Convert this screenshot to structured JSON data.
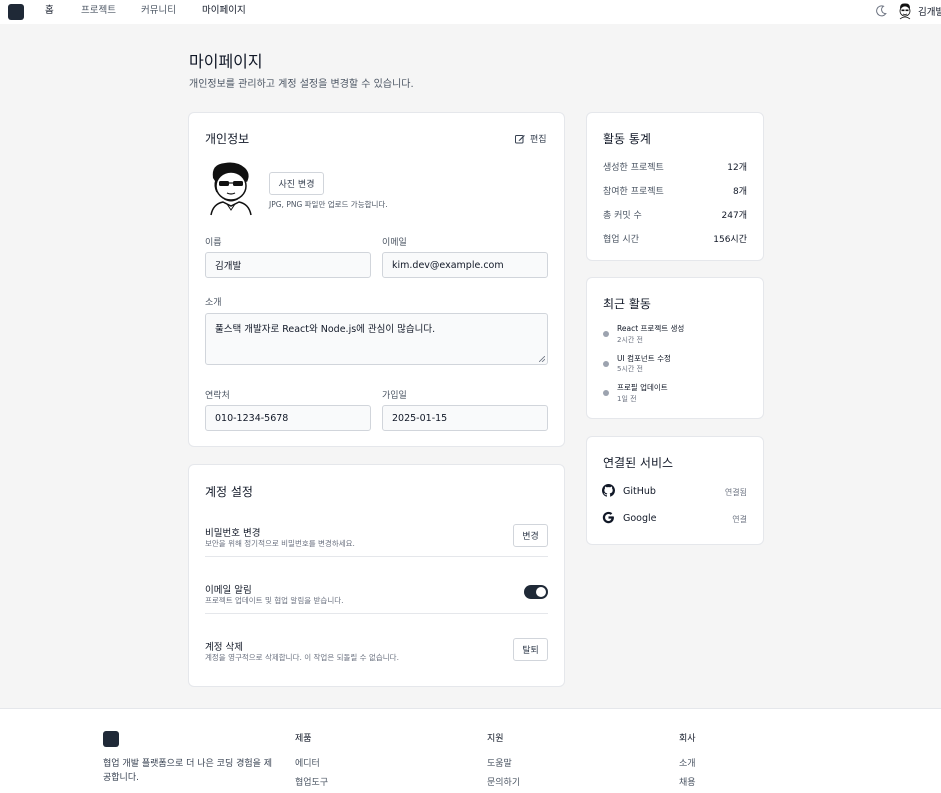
{
  "nav": {
    "items": [
      "홈",
      "프로젝트",
      "커뮤니티",
      "마이페이지"
    ],
    "user_name": "김개발"
  },
  "page": {
    "title": "마이페이지",
    "subtitle": "개인정보를 관리하고 계정 설정을 변경할 수 있습니다."
  },
  "profile": {
    "title": "개인정보",
    "edit_label": "편집",
    "photo_button": "사진 변경",
    "photo_hint": "JPG, PNG 파일만 업로드 가능합니다.",
    "name_label": "이름",
    "name_value": "김개발",
    "email_label": "이메일",
    "email_value": "kim.dev@example.com",
    "bio_label": "소개",
    "bio_value": "풀스택 개발자로 React와 Node.js에 관심이 많습니다.",
    "phone_label": "연락처",
    "phone_value": "010-1234-5678",
    "joined_label": "가입일",
    "joined_value": "2025-01-15"
  },
  "account": {
    "title": "계정 설정",
    "password": {
      "title": "비밀번호 변경",
      "desc": "보안을 위해 정기적으로 비밀번호를 변경하세요.",
      "button": "변경"
    },
    "email_notify": {
      "title": "이메일 알림",
      "desc": "프로젝트 업데이트 및 협업 알림을 받습니다.",
      "enabled": true
    },
    "delete": {
      "title": "계정 삭제",
      "desc": "계정을 영구적으로 삭제합니다. 이 작업은 되돌릴 수 없습니다.",
      "button": "탈퇴"
    }
  },
  "stats": {
    "title": "활동 통계",
    "items": [
      {
        "label": "생성한 프로젝트",
        "value": "12개"
      },
      {
        "label": "참여한 프로젝트",
        "value": "8개"
      },
      {
        "label": "총 커밋 수",
        "value": "247개"
      },
      {
        "label": "협업 시간",
        "value": "156시간"
      }
    ]
  },
  "recent": {
    "title": "최근 활동",
    "items": [
      {
        "title": "React 프로젝트 생성",
        "time": "2시간 전"
      },
      {
        "title": "UI 컴포넌트 수정",
        "time": "5시간 전"
      },
      {
        "title": "프로필 업데이트",
        "time": "1일 전"
      }
    ]
  },
  "services": {
    "title": "연결된 서비스",
    "items": [
      {
        "name": "GitHub",
        "status": "연결됨",
        "icon": "github-icon"
      },
      {
        "name": "Google",
        "status": "연결",
        "icon": "google-icon"
      }
    ]
  },
  "footer": {
    "desc": "협업 개발 플랫폼으로 더 나은 코딩 경험을 제공합니다.",
    "cols": [
      {
        "head": "제품",
        "links": [
          "에디터",
          "협업도구"
        ]
      },
      {
        "head": "지원",
        "links": [
          "도움말",
          "문의하기"
        ]
      },
      {
        "head": "회사",
        "links": [
          "소개",
          "채용"
        ]
      }
    ]
  },
  "colors": {
    "accent": "#1f2937",
    "background": "#f5f5f5",
    "card": "#ffffff"
  }
}
